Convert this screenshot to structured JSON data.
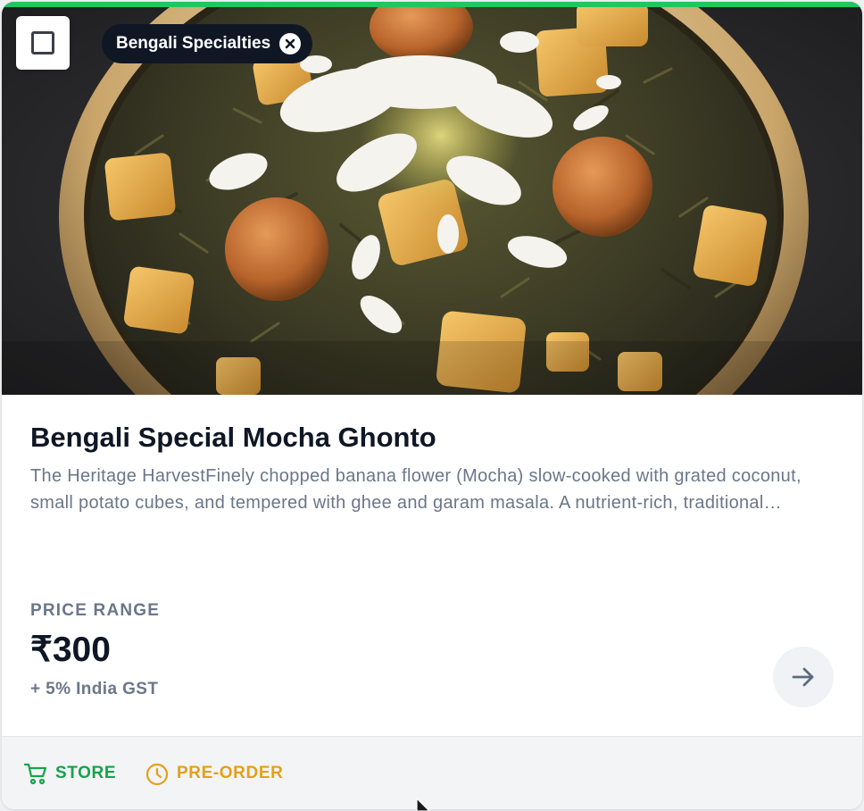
{
  "card": {
    "accent_color": "#22c55e",
    "select_checkbox": {
      "checked": false,
      "icon": "checkbox-empty-icon"
    },
    "category_chip": {
      "label": "Bengali Specialties",
      "icon": "close-circle-icon"
    },
    "image": {
      "subject": "dish-photo"
    },
    "title": "Bengali Special Mocha Ghonto",
    "description": "The Heritage HarvestFinely chopped banana flower (Mocha) slow-cooked with grated coconut, small potato cubes, and tempered with ghee and garam masala. A nutrient-rich, traditional Bengali delicacy.",
    "price": {
      "label": "PRICE RANGE",
      "value": "₹300",
      "tax_note": "+ 5% India GST"
    },
    "arrow_icon": "arrow-right-icon",
    "footer": {
      "store": {
        "label": "STORE",
        "icon": "cart-icon",
        "color": "#16a34a"
      },
      "preorder": {
        "label": "PRE-ORDER",
        "icon": "clock-icon",
        "color": "#e5a017"
      }
    }
  }
}
